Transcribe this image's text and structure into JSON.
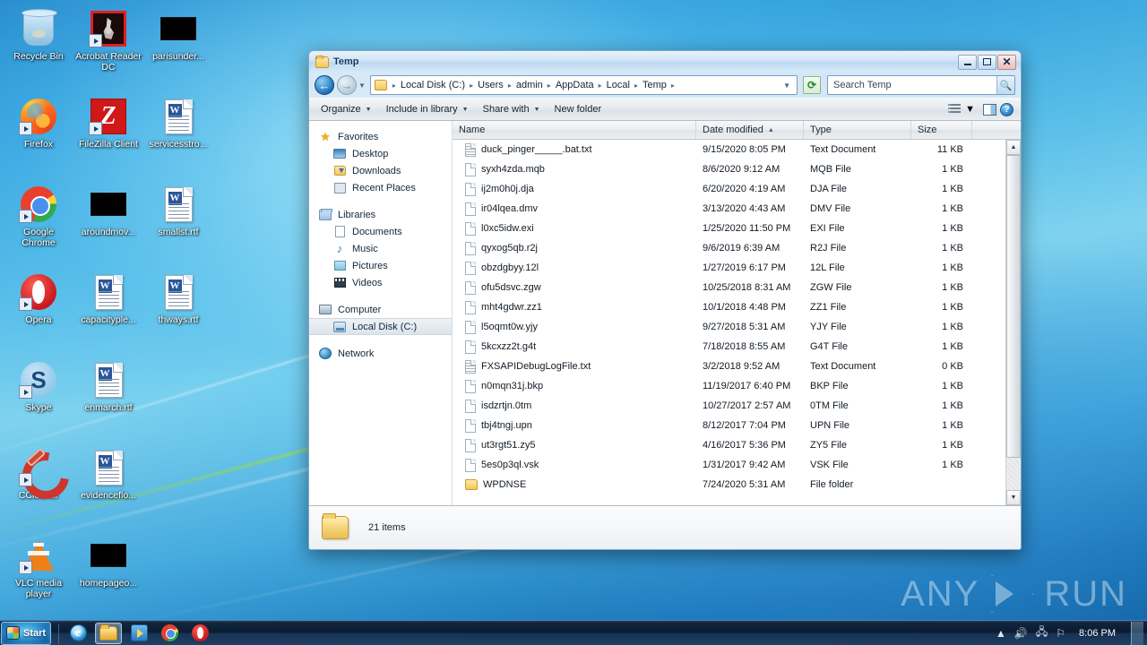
{
  "desktop": {
    "icons": [
      {
        "label": "Recycle Bin",
        "art": "recycle",
        "shortcut": false
      },
      {
        "label": "Acrobat Reader DC",
        "art": "pdf",
        "shortcut": true
      },
      {
        "label": "parisunder...",
        "art": "black",
        "shortcut": false
      },
      {
        "label": "Firefox",
        "art": "firefox",
        "shortcut": true
      },
      {
        "label": "FileZilla Client",
        "art": "filezilla",
        "shortcut": true
      },
      {
        "label": "servicesstro...",
        "art": "rtf",
        "shortcut": false
      },
      {
        "label": "Google Chrome",
        "art": "chrome",
        "shortcut": true
      },
      {
        "label": "aroundmov...",
        "art": "black",
        "shortcut": false
      },
      {
        "label": "smallst.rtf",
        "art": "rtf",
        "shortcut": false
      },
      {
        "label": "Opera",
        "art": "opera",
        "shortcut": true
      },
      {
        "label": "capacityple...",
        "art": "rtf",
        "shortcut": false
      },
      {
        "label": "thways.rtf",
        "art": "rtf",
        "shortcut": false
      },
      {
        "label": "Skype",
        "art": "skype",
        "shortcut": true
      },
      {
        "label": "enmarch.rtf",
        "art": "rtf",
        "shortcut": false
      },
      {
        "label": "",
        "art": "none",
        "shortcut": false
      },
      {
        "label": "CCleaner",
        "art": "ccleaner",
        "shortcut": true
      },
      {
        "label": "evidenceflo...",
        "art": "rtf",
        "shortcut": false
      },
      {
        "label": "",
        "art": "none",
        "shortcut": false
      },
      {
        "label": "VLC media player",
        "art": "vlc",
        "shortcut": true
      },
      {
        "label": "homepageo...",
        "art": "black",
        "shortcut": false
      },
      {
        "label": "",
        "art": "none",
        "shortcut": false
      }
    ]
  },
  "window": {
    "title": "Temp",
    "folder_icon": "folder-icon",
    "controls": {
      "minimize": "minimize-button",
      "maximize": "maximize-button",
      "close": "close-button"
    },
    "nav": {
      "back": "back-button",
      "forward": "forward-button",
      "recent_dropdown": "recent-pages-dropdown",
      "breadcrumbs": [
        "Local Disk (C:)",
        "Users",
        "admin",
        "AppData",
        "Local",
        "Temp"
      ],
      "address_dropdown": "address-dropdown",
      "refresh": "refresh-button"
    },
    "search": {
      "placeholder": "Search Temp",
      "icon": "search-icon"
    },
    "toolbar": {
      "organize": "Organize",
      "include_in_library": "Include in library",
      "share_with": "Share with",
      "new_folder": "New folder",
      "view_options": "view-options-button",
      "preview_pane": "preview-pane-button",
      "help": "help-button"
    }
  },
  "navpane": {
    "groups": [
      {
        "header": {
          "label": "Favorites",
          "icon": "star-icon"
        },
        "items": [
          {
            "label": "Desktop",
            "icon": "desktop-icon",
            "selected": false
          },
          {
            "label": "Downloads",
            "icon": "downloads-icon",
            "selected": false
          },
          {
            "label": "Recent Places",
            "icon": "recent-places-icon",
            "selected": false
          }
        ]
      },
      {
        "header": {
          "label": "Libraries",
          "icon": "libraries-icon"
        },
        "items": [
          {
            "label": "Documents",
            "icon": "documents-icon",
            "selected": false
          },
          {
            "label": "Music",
            "icon": "music-icon",
            "selected": false
          },
          {
            "label": "Pictures",
            "icon": "pictures-icon",
            "selected": false
          },
          {
            "label": "Videos",
            "icon": "videos-icon",
            "selected": false
          }
        ]
      },
      {
        "header": {
          "label": "Computer",
          "icon": "computer-icon"
        },
        "items": [
          {
            "label": "Local Disk (C:)",
            "icon": "local-disk-icon",
            "selected": true
          }
        ]
      },
      {
        "header": {
          "label": "Network",
          "icon": "network-icon"
        },
        "items": []
      }
    ]
  },
  "filelist": {
    "columns": [
      {
        "key": "name",
        "label": "Name",
        "sorted": false
      },
      {
        "key": "date",
        "label": "Date modified",
        "sorted": true,
        "sort_dir": "desc"
      },
      {
        "key": "type",
        "label": "Type",
        "sorted": false
      },
      {
        "key": "size",
        "label": "Size",
        "sorted": false
      }
    ],
    "sort_indicator": "▲",
    "rows": [
      {
        "name": "duck_pinger_____.bat.txt",
        "date": "9/15/2020 8:05 PM",
        "type": "Text Document",
        "size": "11 KB",
        "icon": "text-file-icon"
      },
      {
        "name": "syxh4zda.mqb",
        "date": "8/6/2020 9:12 AM",
        "type": "MQB File",
        "size": "1 KB",
        "icon": "generic-file-icon"
      },
      {
        "name": "ij2m0h0j.dja",
        "date": "6/20/2020 4:19 AM",
        "type": "DJA File",
        "size": "1 KB",
        "icon": "generic-file-icon"
      },
      {
        "name": "ir04lqea.dmv",
        "date": "3/13/2020 4:43 AM",
        "type": "DMV File",
        "size": "1 KB",
        "icon": "generic-file-icon"
      },
      {
        "name": "l0xc5idw.exi",
        "date": "1/25/2020 11:50 PM",
        "type": "EXI File",
        "size": "1 KB",
        "icon": "generic-file-icon"
      },
      {
        "name": "qyxog5qb.r2j",
        "date": "9/6/2019 6:39 AM",
        "type": "R2J File",
        "size": "1 KB",
        "icon": "generic-file-icon"
      },
      {
        "name": "obzdgbyy.12l",
        "date": "1/27/2019 6:17 PM",
        "type": "12L File",
        "size": "1 KB",
        "icon": "generic-file-icon"
      },
      {
        "name": "ofu5dsvc.zgw",
        "date": "10/25/2018 8:31 AM",
        "type": "ZGW File",
        "size": "1 KB",
        "icon": "generic-file-icon"
      },
      {
        "name": "mht4gdwr.zz1",
        "date": "10/1/2018 4:48 PM",
        "type": "ZZ1 File",
        "size": "1 KB",
        "icon": "generic-file-icon"
      },
      {
        "name": "l5oqmt0w.yjy",
        "date": "9/27/2018 5:31 AM",
        "type": "YJY File",
        "size": "1 KB",
        "icon": "generic-file-icon"
      },
      {
        "name": "5kcxzz2t.g4t",
        "date": "7/18/2018 8:55 AM",
        "type": "G4T File",
        "size": "1 KB",
        "icon": "generic-file-icon"
      },
      {
        "name": "FXSAPIDebugLogFile.txt",
        "date": "3/2/2018 9:52 AM",
        "type": "Text Document",
        "size": "0 KB",
        "icon": "text-file-icon"
      },
      {
        "name": "n0mqn31j.bkp",
        "date": "11/19/2017 6:40 PM",
        "type": "BKP File",
        "size": "1 KB",
        "icon": "generic-file-icon"
      },
      {
        "name": "isdzrtjn.0tm",
        "date": "10/27/2017 2:57 AM",
        "type": "0TM File",
        "size": "1 KB",
        "icon": "generic-file-icon"
      },
      {
        "name": "tbj4tngj.upn",
        "date": "8/12/2017 7:04 PM",
        "type": "UPN File",
        "size": "1 KB",
        "icon": "generic-file-icon"
      },
      {
        "name": "ut3rgt51.zy5",
        "date": "4/16/2017 5:36 PM",
        "type": "ZY5 File",
        "size": "1 KB",
        "icon": "generic-file-icon"
      },
      {
        "name": "5es0p3ql.vsk",
        "date": "1/31/2017 9:42 AM",
        "type": "VSK File",
        "size": "1 KB",
        "icon": "generic-file-icon"
      },
      {
        "name": "WPDNSE",
        "date": "7/24/2020 5:31 AM",
        "type": "File folder",
        "size": "",
        "icon": "folder-icon"
      }
    ],
    "scrollbar": {
      "up": "scroll-up-button",
      "down": "scroll-down-button"
    }
  },
  "statusbar": {
    "icon": "folder-icon",
    "item_count": "21 items"
  },
  "watermark": {
    "left": "ANY",
    "right": "RUN"
  },
  "taskbar": {
    "start": "Start",
    "buttons": [
      {
        "name": "internet-explorer",
        "art": "ie",
        "active": false
      },
      {
        "name": "windows-explorer",
        "art": "exp",
        "active": true
      },
      {
        "name": "media-player",
        "art": "wmp",
        "active": false
      },
      {
        "name": "google-chrome",
        "art": "chrome",
        "active": false
      },
      {
        "name": "opera",
        "art": "opera",
        "active": false
      }
    ],
    "tray": {
      "show_hidden": "▲",
      "volume": "volume-icon",
      "network": "network-icon",
      "flag": "action-center-icon",
      "clock": "8:06 PM"
    }
  }
}
